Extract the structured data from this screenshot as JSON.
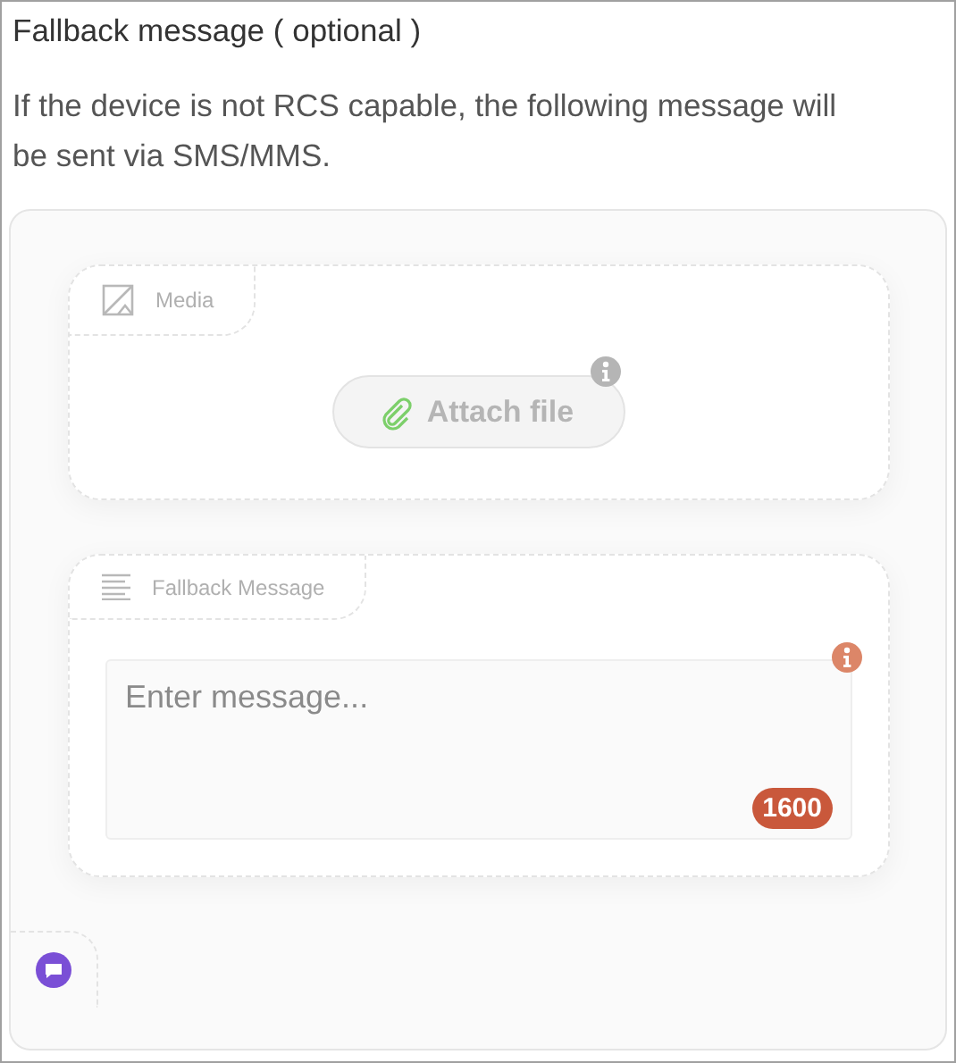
{
  "title": "Fallback message ( optional )",
  "description": "If the device is not RCS capable, the following message will be sent via SMS/MMS.",
  "media": {
    "label": "Media",
    "attach_button": "Attach file"
  },
  "message": {
    "label": "Fallback Message",
    "placeholder": "Enter message...",
    "counter": "1600"
  }
}
